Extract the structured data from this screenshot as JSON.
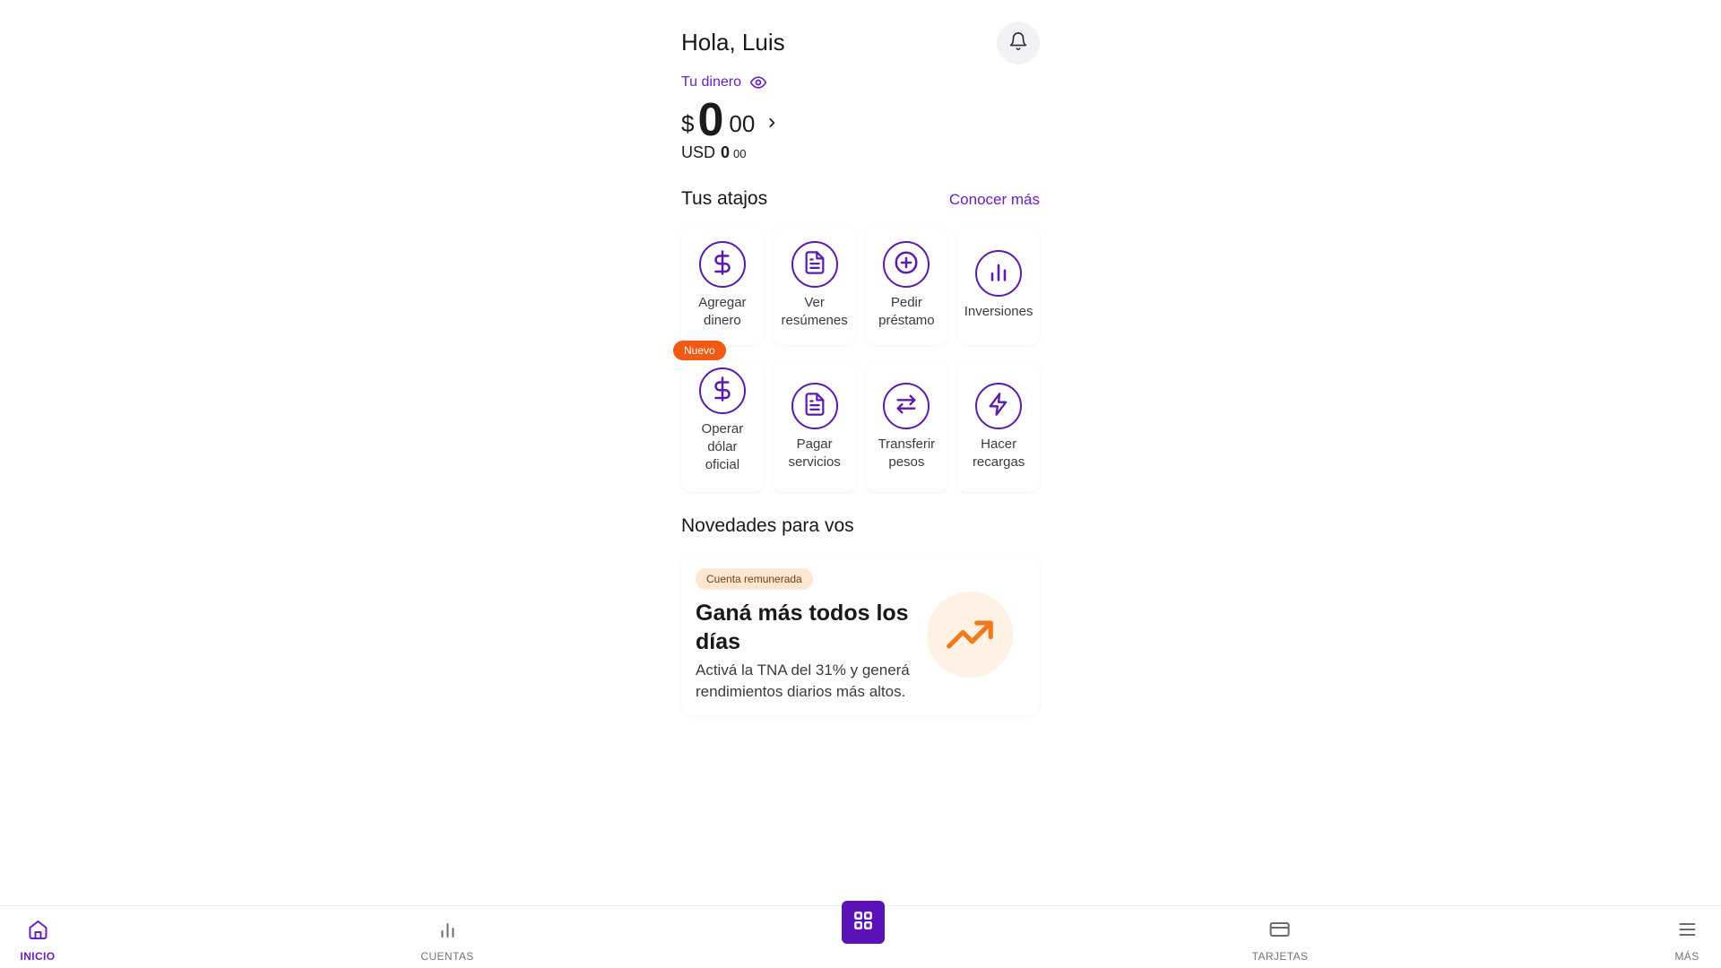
{
  "header": {
    "greeting": "Hola, Luis",
    "bell_icon": "bell-icon"
  },
  "balance": {
    "label": "Tu dinero",
    "eye_icon": "eye-icon",
    "currency_symbol": "$",
    "integer": "0",
    "decimals": "00",
    "usd_label": "USD",
    "usd_integer": "0",
    "usd_decimals": "00"
  },
  "shortcuts": {
    "title": "Tus atajos",
    "link": "Conocer más",
    "new_badge": "Nuevo",
    "items": [
      {
        "line1": "Agregar",
        "line2": "dinero",
        "line3": "",
        "icon": "dollar-icon"
      },
      {
        "line1": "Ver",
        "line2": "resúmenes",
        "line3": "",
        "icon": "document-icon"
      },
      {
        "line1": "Pedir",
        "line2": "préstamo",
        "line3": "",
        "icon": "plus-circle-icon"
      },
      {
        "line1": "Inversiones",
        "line2": "",
        "line3": "",
        "icon": "bar-chart-icon"
      },
      {
        "line1": "Operar",
        "line2": "dólar",
        "line3": "oficial",
        "icon": "dollar-icon"
      },
      {
        "line1": "Pagar",
        "line2": "servicios",
        "line3": "",
        "icon": "document-icon"
      },
      {
        "line1": "Transferir",
        "line2": "pesos",
        "line3": "",
        "icon": "transfer-icon"
      },
      {
        "line1": "Hacer",
        "line2": "recargas",
        "line3": "",
        "icon": "lightning-icon"
      }
    ]
  },
  "news": {
    "title": "Novedades para vos",
    "card": {
      "tag": "Cuenta remunerada",
      "title": "Ganá más todos los días",
      "description": "Activá la TNA del 31% y generá rendimientos diarios más altos.",
      "icon": "trending-up-icon"
    }
  },
  "nav": {
    "items": [
      {
        "label": "INICIO",
        "icon": "home-icon"
      },
      {
        "label": "CUENTAS",
        "icon": "bar-chart-icon"
      },
      {
        "label": "TARJETAS",
        "icon": "credit-card-icon"
      },
      {
        "label": "MÁS",
        "icon": "menu-icon"
      }
    ],
    "center_icon": "grid-icon"
  },
  "colors": {
    "accent": "#5b13b8",
    "link": "#6a1fc4",
    "badge": "#f05a14",
    "promo_tag_bg": "#fde6d2",
    "trend": "#f07a1a"
  }
}
